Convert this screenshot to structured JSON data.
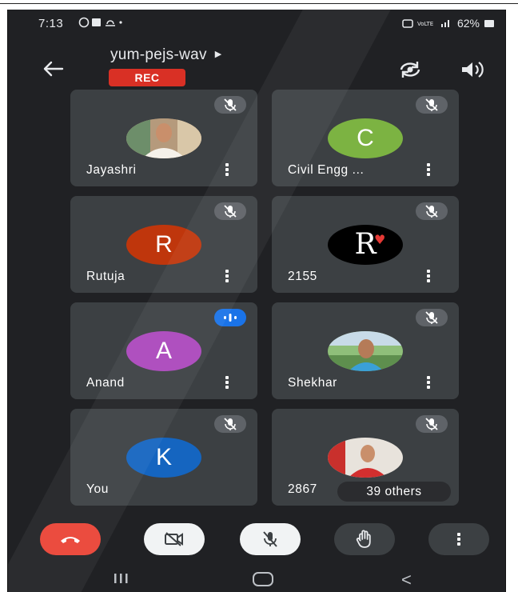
{
  "status_bar": {
    "time": "7:13",
    "notification_icons": "whatsapp-icon gallery-icon weather-icon dot",
    "right_text": "62%"
  },
  "meeting": {
    "code": "yum-pejs-wav",
    "rec_label": "REC"
  },
  "tiles": [
    {
      "name": "Jayashri",
      "avatar": "photo",
      "muted": true
    },
    {
      "name": "Civil Engg ...",
      "avatar_letter": "C",
      "avatar_color": "#7cb342",
      "muted": true
    },
    {
      "name": "Rutuja",
      "avatar_letter": "R",
      "avatar_color": "#bf360c",
      "muted": true
    },
    {
      "name": "2155",
      "avatar_letter": "R",
      "avatar_color": "#000000",
      "muted": true
    },
    {
      "name": "Anand",
      "avatar_letter": "A",
      "avatar_color": "#ab47bc",
      "muted": false,
      "speaking": true
    },
    {
      "name": "Shekhar",
      "avatar": "photo",
      "muted": true
    },
    {
      "name": "You",
      "avatar_letter": "K",
      "avatar_color": "#1565c0",
      "muted": true
    },
    {
      "name": "2867",
      "avatar": "photo",
      "muted": true,
      "others_label": "39 others"
    }
  ],
  "controls": {
    "end_color": "#ea4335",
    "icons": [
      "end-call-icon",
      "camera-off-icon",
      "mic-off-icon",
      "raise-hand-icon",
      "more-options-icon"
    ]
  },
  "colors": {
    "background": "#202124",
    "tile": "#3c4043",
    "rec": "#d93025",
    "speaking": "#1a73e8"
  }
}
